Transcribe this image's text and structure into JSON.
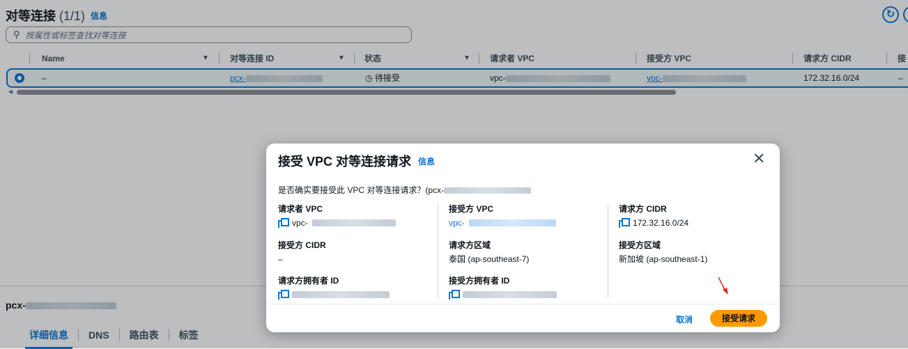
{
  "page": {
    "title": "对等连接",
    "count": "(1/1)",
    "info_link": "信息",
    "search_placeholder": "按属性或标签查找对等连接"
  },
  "table": {
    "columns": [
      "Name",
      "对等连接 ID",
      "状态",
      "请求者 VPC",
      "接受方 VPC",
      "请求方 CIDR",
      "接"
    ],
    "rows": [
      {
        "name": "–",
        "peering_id": "pcx-",
        "status": "待接受",
        "requester_vpc": "vpc-",
        "accepter_vpc": "vpc-",
        "requester_cidr": "172.32.16.0/24",
        "extra": "–"
      }
    ]
  },
  "details": {
    "title": "pcx-",
    "tabs": [
      "详细信息",
      "DNS",
      "路由表",
      "标签"
    ]
  },
  "modal": {
    "title": "接受 VPC 对等连接请求",
    "info_link": "信息",
    "confirm_text": "是否确实要接受此 VPC 对等连接请求？(pcx-",
    "fields": {
      "requester_vpc": {
        "label": "请求者 VPC",
        "value": "vpc-"
      },
      "accepter_vpc": {
        "label": "接受方 VPC",
        "value": "vpc-"
      },
      "requester_cidr": {
        "label": "请求方 CIDR",
        "value": "172.32.16.0/24"
      },
      "accepter_cidr": {
        "label": "接受方 CIDR",
        "value": "–"
      },
      "requester_region": {
        "label": "请求方区域",
        "value": "泰国 (ap-southeast-7)"
      },
      "accepter_region": {
        "label": "接受方区域",
        "value": "新加坡 (ap-southeast-1)"
      },
      "requester_owner": {
        "label": "请求方拥有者 ID",
        "value": ""
      },
      "accepter_owner": {
        "label": "接受方拥有者 ID",
        "value": ""
      }
    },
    "cancel_label": "取消",
    "accept_label": "接受请求"
  },
  "colors": {
    "accent": "#0972d3",
    "primary_button": "#ff9900",
    "annotation_arrow": "#e02020"
  }
}
